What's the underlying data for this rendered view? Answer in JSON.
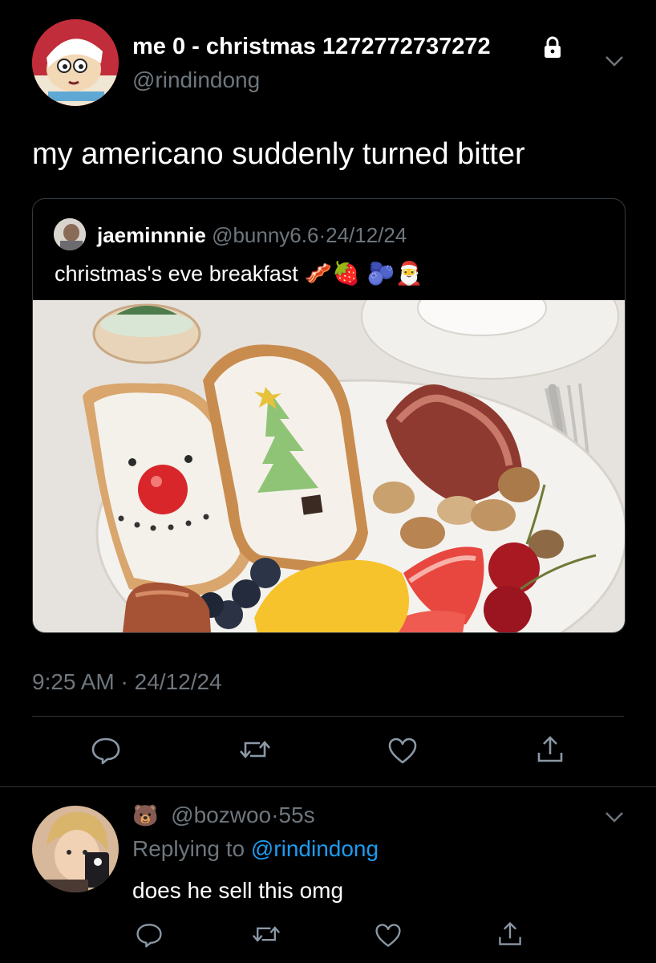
{
  "tweet": {
    "display_name": "me 0 - christmas 1272772737272",
    "handle": "@rindindong",
    "text": "my americano suddenly turned bitter",
    "time": "9:25 AM",
    "date_sep": "·",
    "date": "24/12/24",
    "locked_icon": "lock-icon",
    "menu_icon": "chevron-down-icon",
    "avatar_icon": "cartoon-avatar"
  },
  "quote": {
    "display_name": "jaeminnnie",
    "handle": "@bunny6.6",
    "sep": "·",
    "date": "24/12/24",
    "text": "christmas's eve breakfast",
    "emojis": "🥓🍓 🫐🎅",
    "image": "breakfast-photo"
  },
  "actions": {
    "reply_icon": "reply-icon",
    "retweet_icon": "retweet-icon",
    "like_icon": "heart-icon",
    "share_icon": "share-icon"
  },
  "reply": {
    "name_emoji": "🐻",
    "handle": "@bozwoo",
    "sep": "·",
    "age": "55s",
    "replying_prefix": "Replying to",
    "replying_to": "@rindindong",
    "text": "does he sell this omg",
    "menu_icon": "chevron-down-icon"
  },
  "colors": {
    "background": "#000000",
    "text": "#ffffff",
    "muted": "#6e767d",
    "link": "#1d9bf0",
    "divider": "#2f3336"
  }
}
